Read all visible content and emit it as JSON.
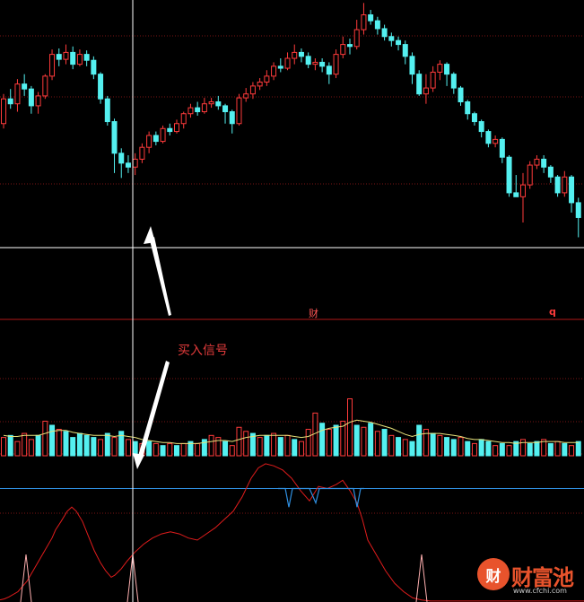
{
  "annotations": {
    "buy_signal": "买入信号",
    "marker_left": "财",
    "marker_right": "q"
  },
  "watermark": {
    "glyph": "财",
    "text": "财富池",
    "url": "www.cfchi.com"
  },
  "colors": {
    "up": "#ff3b3b",
    "down": "#54f0f0",
    "grid": "#7a1414",
    "crosshair": "#ffffff",
    "ma_volume": "#e8e27a",
    "indicator_line": "#e01c1c",
    "threshold_line": "#2f8fe0",
    "buy_arrow": "#ffffff"
  },
  "chart_data": [
    {
      "type": "candlestick",
      "title": "",
      "candles": [
        [
          0,
          60,
          85,
          90,
          55
        ],
        [
          1,
          85,
          80,
          95,
          75
        ],
        [
          2,
          80,
          100,
          105,
          72
        ],
        [
          3,
          100,
          95,
          110,
          88
        ],
        [
          4,
          95,
          78,
          98,
          70
        ],
        [
          5,
          78,
          88,
          92,
          70
        ],
        [
          6,
          88,
          108,
          110,
          85
        ],
        [
          7,
          108,
          130,
          135,
          104
        ],
        [
          8,
          130,
          125,
          136,
          118
        ],
        [
          9,
          125,
          132,
          140,
          120
        ],
        [
          10,
          132,
          120,
          138,
          115
        ],
        [
          11,
          120,
          130,
          135,
          118
        ],
        [
          12,
          130,
          124,
          134,
          118
        ],
        [
          13,
          124,
          110,
          128,
          105
        ],
        [
          14,
          110,
          85,
          112,
          80
        ],
        [
          15,
          85,
          62,
          88,
          58
        ],
        [
          16,
          62,
          30,
          65,
          10
        ],
        [
          17,
          30,
          20,
          35,
          5
        ],
        [
          18,
          20,
          16,
          28,
          10
        ],
        [
          19,
          16,
          24,
          30,
          8
        ],
        [
          20,
          24,
          36,
          40,
          20
        ],
        [
          21,
          36,
          48,
          52,
          30
        ],
        [
          22,
          48,
          42,
          52,
          38
        ],
        [
          23,
          42,
          55,
          58,
          40
        ],
        [
          24,
          55,
          52,
          60,
          48
        ],
        [
          25,
          52,
          60,
          64,
          50
        ],
        [
          26,
          60,
          70,
          72,
          55
        ],
        [
          27,
          70,
          76,
          80,
          66
        ],
        [
          28,
          76,
          72,
          82,
          68
        ],
        [
          29,
          72,
          80,
          86,
          70
        ],
        [
          30,
          80,
          82,
          86,
          76
        ],
        [
          31,
          82,
          78,
          88,
          74
        ],
        [
          32,
          78,
          72,
          80,
          60
        ],
        [
          33,
          72,
          60,
          74,
          50
        ],
        [
          34,
          60,
          86,
          90,
          58
        ],
        [
          35,
          86,
          90,
          96,
          82
        ],
        [
          36,
          90,
          98,
          102,
          85
        ],
        [
          37,
          98,
          102,
          106,
          94
        ],
        [
          38,
          102,
          108,
          114,
          98
        ],
        [
          39,
          108,
          118,
          122,
          104
        ],
        [
          40,
          118,
          116,
          126,
          112
        ],
        [
          41,
          116,
          126,
          132,
          114
        ],
        [
          42,
          126,
          132,
          140,
          120
        ],
        [
          43,
          132,
          128,
          136,
          122
        ],
        [
          44,
          128,
          120,
          132,
          116
        ],
        [
          45,
          120,
          122,
          126,
          114
        ],
        [
          46,
          122,
          118,
          126,
          112
        ],
        [
          47,
          118,
          110,
          122,
          100
        ],
        [
          48,
          110,
          130,
          135,
          106
        ],
        [
          49,
          130,
          140,
          148,
          126
        ],
        [
          50,
          140,
          138,
          146,
          130
        ],
        [
          51,
          138,
          155,
          165,
          135
        ],
        [
          52,
          155,
          170,
          182,
          150
        ],
        [
          53,
          170,
          164,
          175,
          160
        ],
        [
          54,
          164,
          156,
          168,
          150
        ],
        [
          55,
          156,
          148,
          160,
          144
        ],
        [
          56,
          148,
          144,
          152,
          138
        ],
        [
          57,
          144,
          140,
          148,
          134
        ],
        [
          58,
          140,
          128,
          144,
          120
        ],
        [
          59,
          128,
          110,
          132,
          100
        ],
        [
          60,
          110,
          90,
          114,
          88
        ],
        [
          61,
          90,
          96,
          110,
          80
        ],
        [
          62,
          96,
          112,
          118,
          92
        ],
        [
          63,
          112,
          120,
          124,
          104
        ],
        [
          64,
          120,
          110,
          122,
          98
        ],
        [
          65,
          110,
          96,
          112,
          90
        ],
        [
          66,
          96,
          82,
          98,
          78
        ],
        [
          67,
          82,
          70,
          84,
          64
        ],
        [
          68,
          70,
          62,
          72,
          58
        ],
        [
          69,
          62,
          52,
          64,
          46
        ],
        [
          70,
          52,
          40,
          54,
          36
        ],
        [
          71,
          40,
          44,
          48,
          36
        ],
        [
          72,
          44,
          26,
          46,
          20
        ],
        [
          73,
          26,
          -10,
          28,
          -14
        ],
        [
          74,
          -10,
          -14,
          8,
          -14
        ],
        [
          75,
          -14,
          -2,
          10,
          -40
        ],
        [
          76,
          -2,
          18,
          22,
          -6
        ],
        [
          77,
          18,
          24,
          28,
          14
        ],
        [
          78,
          24,
          16,
          28,
          10
        ],
        [
          79,
          16,
          6,
          18,
          0
        ],
        [
          80,
          6,
          -10,
          8,
          -14
        ],
        [
          81,
          -10,
          6,
          12,
          -14
        ],
        [
          82,
          6,
          -20,
          8,
          -30
        ],
        [
          83,
          -20,
          -35,
          -15,
          -55
        ]
      ],
      "ylim": [
        -60,
        185
      ]
    },
    {
      "type": "bar",
      "title": "",
      "values": [
        [
          0,
          18,
          1
        ],
        [
          1,
          20,
          0
        ],
        [
          2,
          14,
          1
        ],
        [
          3,
          22,
          1
        ],
        [
          4,
          16,
          1
        ],
        [
          5,
          20,
          0
        ],
        [
          6,
          34,
          1
        ],
        [
          7,
          30,
          0
        ],
        [
          8,
          26,
          1
        ],
        [
          9,
          24,
          0
        ],
        [
          10,
          18,
          0
        ],
        [
          11,
          22,
          0
        ],
        [
          12,
          20,
          0
        ],
        [
          13,
          18,
          0
        ],
        [
          14,
          16,
          1
        ],
        [
          15,
          22,
          0
        ],
        [
          16,
          18,
          1
        ],
        [
          17,
          24,
          0
        ],
        [
          18,
          16,
          1
        ],
        [
          19,
          14,
          0
        ],
        [
          20,
          12,
          1
        ],
        [
          21,
          14,
          0
        ],
        [
          22,
          12,
          1
        ],
        [
          23,
          10,
          0
        ],
        [
          24,
          12,
          1
        ],
        [
          25,
          10,
          0
        ],
        [
          26,
          12,
          1
        ],
        [
          27,
          14,
          0
        ],
        [
          28,
          12,
          1
        ],
        [
          29,
          16,
          0
        ],
        [
          30,
          20,
          1
        ],
        [
          31,
          18,
          1
        ],
        [
          32,
          14,
          0
        ],
        [
          33,
          10,
          1
        ],
        [
          34,
          28,
          1
        ],
        [
          35,
          24,
          1
        ],
        [
          36,
          22,
          0
        ],
        [
          37,
          18,
          1
        ],
        [
          38,
          20,
          0
        ],
        [
          39,
          22,
          1
        ],
        [
          40,
          18,
          0
        ],
        [
          41,
          20,
          1
        ],
        [
          42,
          16,
          0
        ],
        [
          43,
          14,
          1
        ],
        [
          44,
          26,
          1
        ],
        [
          45,
          42,
          1
        ],
        [
          46,
          32,
          0
        ],
        [
          47,
          26,
          1
        ],
        [
          48,
          30,
          0
        ],
        [
          49,
          34,
          1
        ],
        [
          50,
          56,
          1
        ],
        [
          51,
          30,
          0
        ],
        [
          52,
          28,
          1
        ],
        [
          53,
          32,
          0
        ],
        [
          54,
          24,
          1
        ],
        [
          55,
          26,
          0
        ],
        [
          56,
          20,
          1
        ],
        [
          57,
          18,
          0
        ],
        [
          58,
          16,
          1
        ],
        [
          59,
          14,
          0
        ],
        [
          60,
          30,
          0
        ],
        [
          61,
          26,
          1
        ],
        [
          62,
          22,
          0
        ],
        [
          63,
          20,
          1
        ],
        [
          64,
          18,
          0
        ],
        [
          65,
          16,
          0
        ],
        [
          66,
          18,
          1
        ],
        [
          67,
          14,
          0
        ],
        [
          68,
          12,
          1
        ],
        [
          69,
          16,
          0
        ],
        [
          70,
          14,
          0
        ],
        [
          71,
          10,
          1
        ],
        [
          72,
          12,
          0
        ],
        [
          73,
          10,
          1
        ],
        [
          74,
          14,
          0
        ],
        [
          75,
          16,
          1
        ],
        [
          76,
          12,
          0
        ],
        [
          77,
          14,
          0
        ],
        [
          78,
          16,
          1
        ],
        [
          79,
          12,
          0
        ],
        [
          80,
          14,
          1
        ],
        [
          81,
          12,
          0
        ],
        [
          82,
          10,
          1
        ],
        [
          83,
          14,
          0
        ]
      ],
      "ma": [
        20,
        19,
        19,
        20,
        20,
        20,
        22,
        24,
        25,
        25,
        23,
        22,
        21,
        20,
        20,
        20,
        19,
        20,
        19,
        18,
        16,
        15,
        14,
        13,
        13,
        12,
        12,
        12,
        12,
        13,
        14,
        15,
        15,
        14,
        16,
        18,
        19,
        20,
        20,
        20,
        20,
        20,
        19,
        18,
        19,
        22,
        25,
        27,
        28,
        29,
        33,
        35,
        34,
        33,
        31,
        29,
        27,
        24,
        21,
        19,
        21,
        22,
        22,
        22,
        21,
        20,
        19,
        17,
        16,
        16,
        15,
        14,
        13,
        13,
        12,
        13,
        13,
        13,
        14,
        14,
        14,
        13,
        13,
        13
      ],
      "ylim": [
        0,
        60
      ]
    },
    {
      "type": "line",
      "title": "",
      "series": [
        {
          "x": [
            0,
            5,
            10,
            20,
            30,
            40,
            50,
            58,
            62,
            68,
            75,
            80,
            85,
            92,
            98,
            105,
            112,
            118,
            124,
            128,
            135,
            142,
            150,
            160,
            170,
            180,
            190,
            200,
            210,
            220,
            230,
            240,
            250,
            260,
            270,
            280,
            288,
            296,
            305,
            315,
            325,
            335,
            345,
            355,
            365,
            375,
            382,
            390,
            398,
            404,
            410,
            420,
            430,
            440,
            450,
            460,
            470,
            480,
            490,
            500,
            510,
            520,
            530,
            540,
            550,
            560,
            570,
            580,
            590,
            600,
            610,
            620,
            630,
            640,
            651
          ],
          "y": [
            2,
            3,
            5,
            10,
            20,
            35,
            50,
            62,
            70,
            78,
            88,
            92,
            88,
            78,
            65,
            50,
            38,
            30,
            24,
            26,
            32,
            40,
            48,
            56,
            62,
            66,
            68,
            66,
            62,
            60,
            66,
            72,
            80,
            88,
            102,
            120,
            130,
            134,
            132,
            128,
            120,
            108,
            98,
            112,
            110,
            114,
            118,
            108,
            96,
            80,
            60,
            45,
            30,
            18,
            10,
            4,
            2,
            1,
            1,
            1,
            1,
            1,
            1,
            1,
            1,
            1,
            1,
            1,
            1,
            1,
            1,
            1,
            1,
            1,
            1
          ]
        },
        {
          "x": [
            310,
            318,
            322,
            326,
            345,
            348,
            352,
            356,
            390,
            394,
            398,
            402,
            406
          ],
          "y": [
            110,
            110,
            92,
            110,
            110,
            104,
            96,
            110,
            110,
            110,
            92,
            110,
            110
          ]
        }
      ],
      "threshold": 110,
      "spikes": [
        29,
        148,
        470
      ],
      "ylim": [
        0,
        140
      ]
    }
  ]
}
